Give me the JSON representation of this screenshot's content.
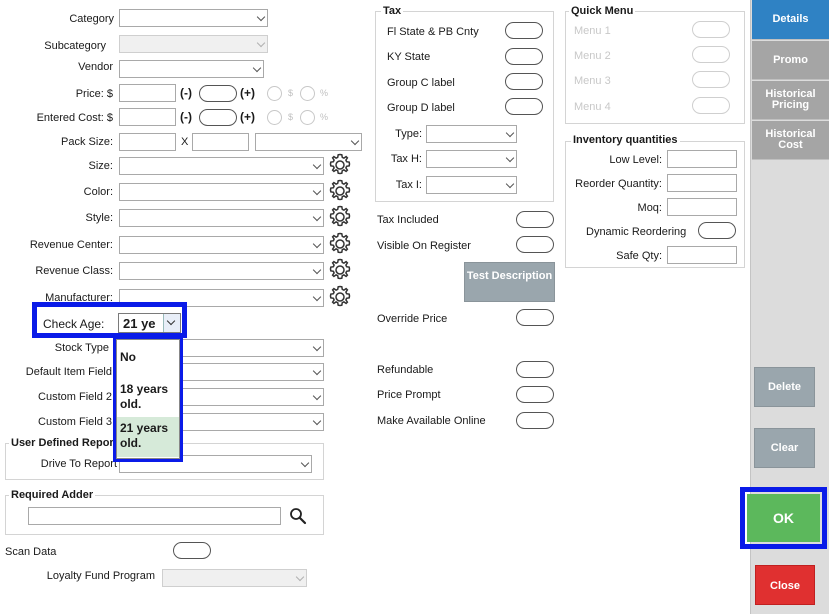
{
  "left": {
    "category_label": "Category",
    "subcategory_label": "Subcategory",
    "vendor_label": "Vendor",
    "price_label": "Price: $",
    "entered_cost_label": "Entered Cost: $",
    "minus_label": "(-)",
    "plus_label": "(+)",
    "dollar_symbol": "$",
    "percent_symbol": "%",
    "pack_size_label": "Pack Size:",
    "pack_x": "X",
    "size_label": "Size:",
    "color_label": "Color:",
    "style_label": "Style:",
    "revenue_center_label": "Revenue Center:",
    "revenue_class_label": "Revenue Class:",
    "manufacturer_label": "Manufacturer:",
    "check_age_label": "Check Age:",
    "check_age_value": "21 ye",
    "stock_type_label": "Stock Type",
    "default_item_field_label": "Default Item Field",
    "custom_field2_label": "Custom Field 2",
    "custom_field3_label": "Custom Field 3",
    "user_defined_reports_label": "User Defined Repor",
    "drive_to_report_label": "Drive To Report",
    "required_adder_label": "Required Adder",
    "scan_data_label": "Scan Data",
    "loyalty_fund_label": "Loyalty Fund Program"
  },
  "dropdown": {
    "options": [
      "No",
      "18 years old.",
      "21 years old."
    ],
    "selected_index": 2
  },
  "tax": {
    "title": "Tax",
    "fl_state": "Fl State & PB Cnty",
    "ky_state": "KY State",
    "group_c": "Group C label",
    "group_d": "Group D label",
    "type_label": "Type:",
    "tax_h_label": "Tax H:",
    "tax_i_label": "Tax I:"
  },
  "middle": {
    "tax_included": "Tax Included",
    "visible_on_register": "Visible On Register",
    "test_description": "Test Description",
    "override_price": "Override Price",
    "refundable": "Refundable",
    "price_prompt": "Price Prompt",
    "make_available_online": "Make Available Online"
  },
  "quick_menu": {
    "title": "Quick Menu",
    "items": [
      "Menu 1",
      "Menu 2",
      "Menu 3",
      "Menu 4"
    ]
  },
  "inventory": {
    "title": "Inventory quantities",
    "low_level": "Low Level:",
    "reorder_quantity": "Reorder Quantity:",
    "moq": "Moq:",
    "dynamic_reordering": "Dynamic Reordering",
    "safe_qty": "Safe Qty:"
  },
  "sidebar": {
    "details": "Details",
    "promo": "Promo",
    "historical_pricing": "Historical Pricing",
    "historical_cost": "Historical Cost",
    "delete": "Delete",
    "clear": "Clear",
    "ok": "OK",
    "close": "Close"
  },
  "colors": {
    "details_tab": "#2f82c4",
    "tab_grey": "#a5a5a5",
    "button_grey": "#9aa6ad",
    "ok_green": "#5cb85c",
    "close_red": "#e03030",
    "highlight_blue": "#0a1be8",
    "selected_option": "#d6ead9"
  },
  "icons": {
    "settings": "gear-icon",
    "search": "search-icon"
  }
}
